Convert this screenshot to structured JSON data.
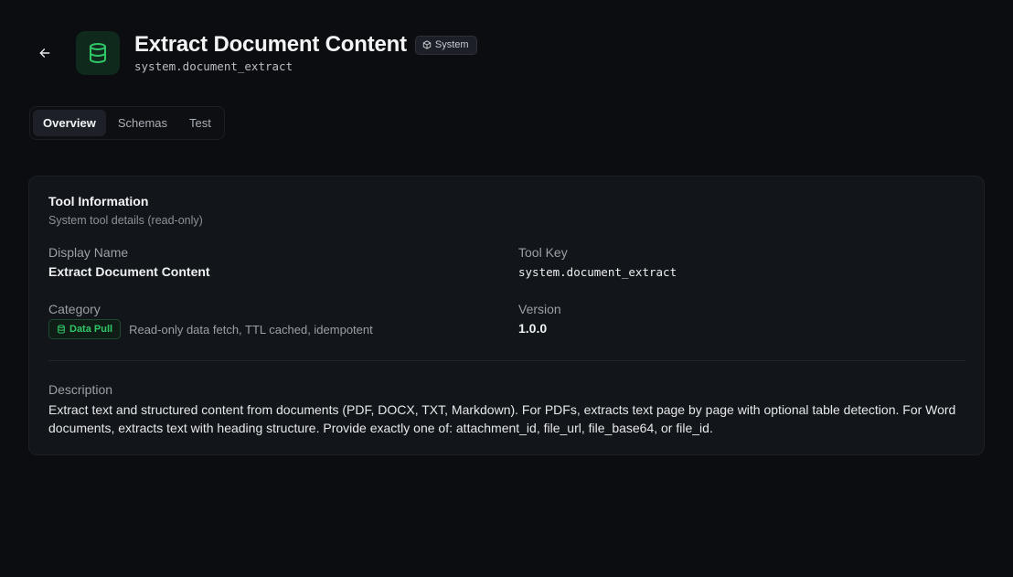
{
  "header": {
    "title": "Extract Document Content",
    "system_badge": "System",
    "tool_key": "system.document_extract"
  },
  "tabs": [
    {
      "label": "Overview",
      "active": true
    },
    {
      "label": "Schemas",
      "active": false
    },
    {
      "label": "Test",
      "active": false
    }
  ],
  "card": {
    "title": "Tool Information",
    "subtitle": "System tool details (read-only)",
    "fields": {
      "display_name_label": "Display Name",
      "display_name_value": "Extract Document Content",
      "tool_key_label": "Tool Key",
      "tool_key_value": "system.document_extract",
      "category_label": "Category",
      "category_badge": "Data Pull",
      "category_desc": "Read-only data fetch, TTL cached, idempotent",
      "version_label": "Version",
      "version_value": "1.0.0",
      "description_label": "Description",
      "description_value": "Extract text and structured content from documents (PDF, DOCX, TXT, Markdown). For PDFs, extracts text page by page with optional table detection. For Word documents, extracts text with heading structure. Provide exactly one of: attachment_id, file_url, file_base64, or file_id."
    }
  },
  "icons": {
    "back": "arrow-left-icon",
    "tool": "database-icon",
    "system": "cube-icon",
    "category": "database-icon"
  },
  "colors": {
    "accent_green": "#30c767",
    "background": "#0b0d10",
    "card": "#121519"
  }
}
